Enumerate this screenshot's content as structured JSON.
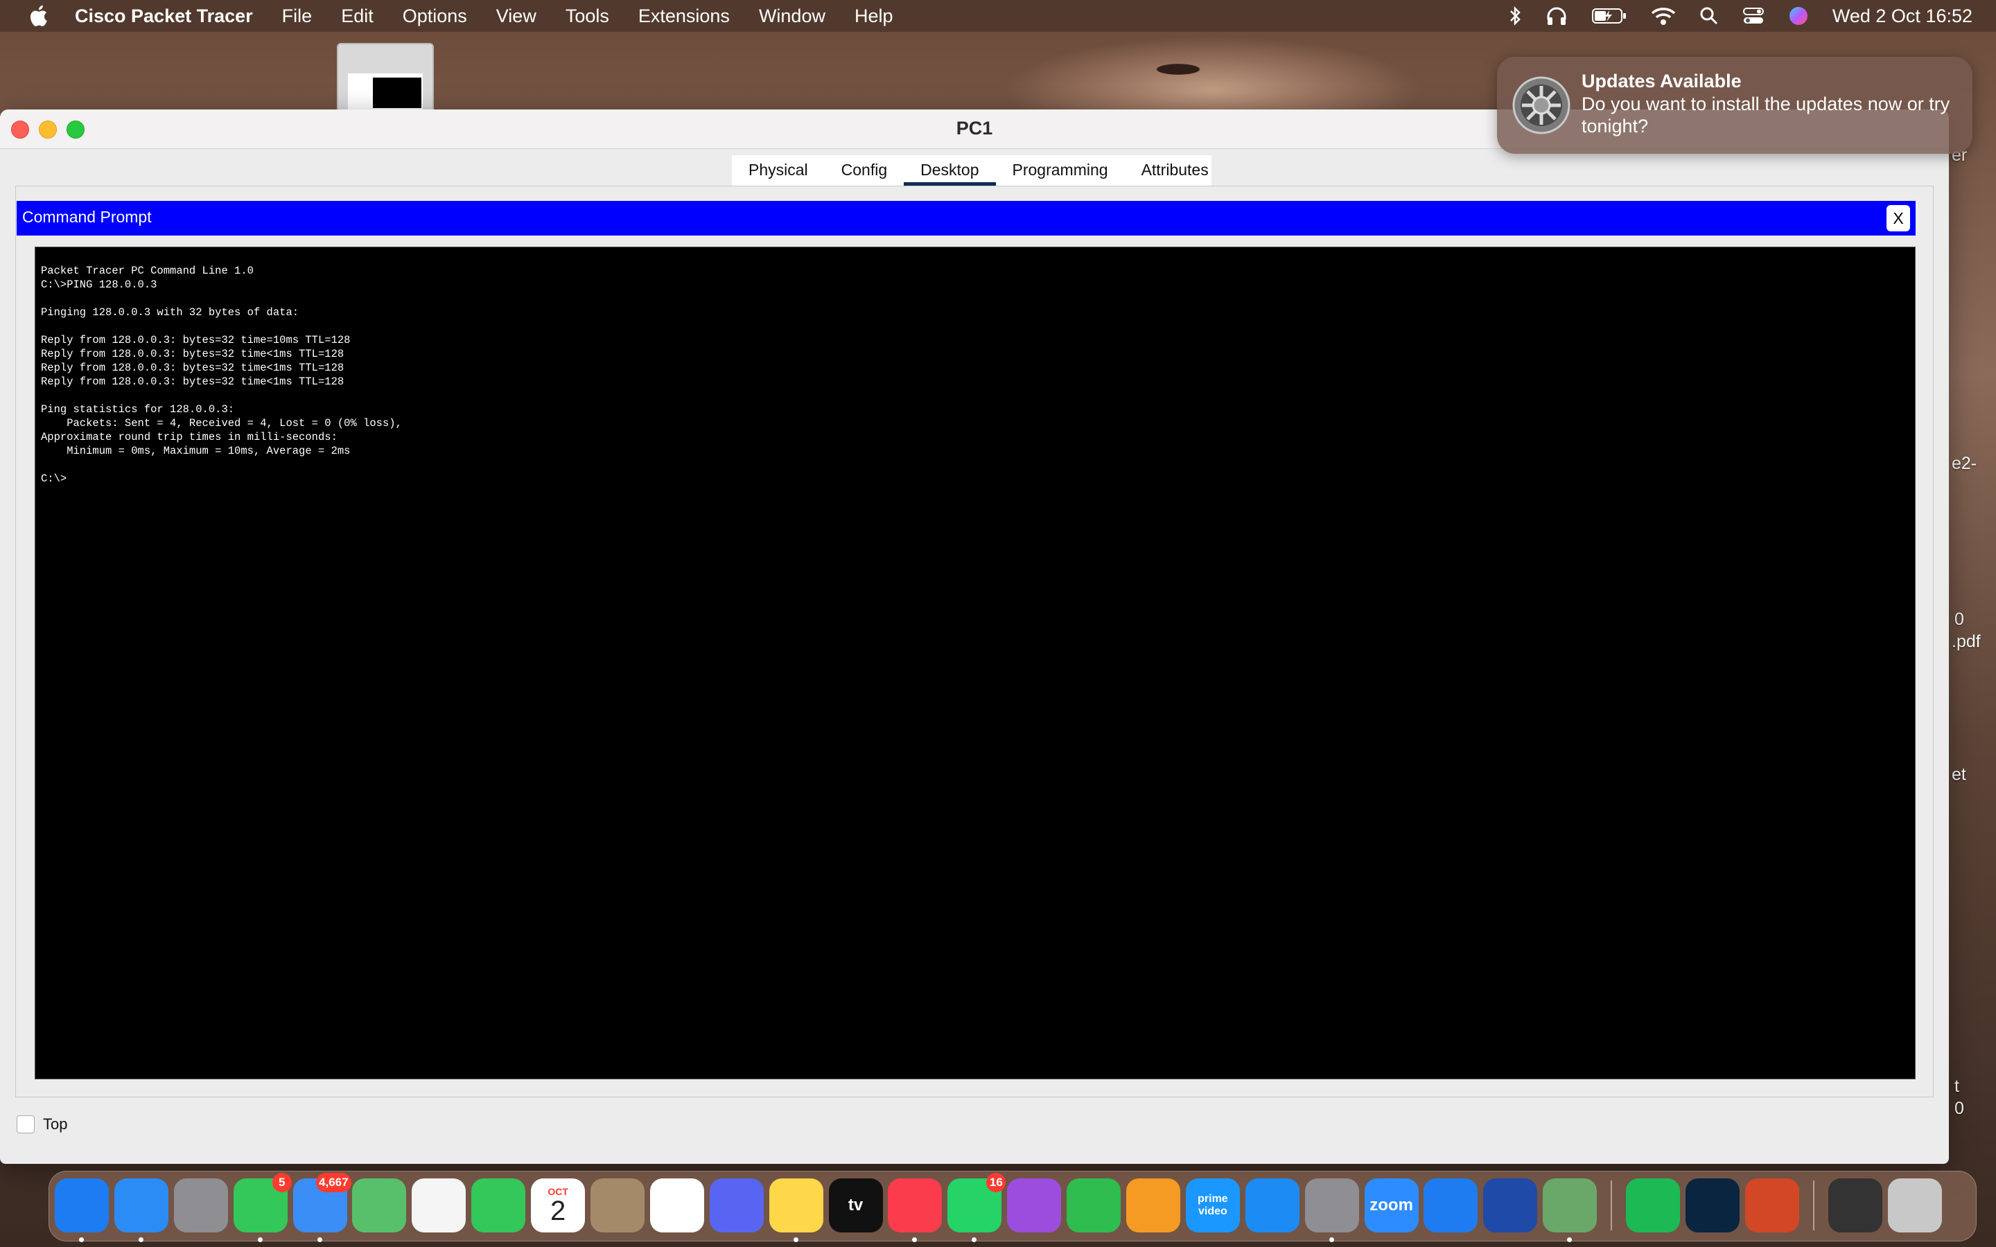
{
  "menubar": {
    "app_name": "Cisco Packet Tracer",
    "menus": [
      "File",
      "Edit",
      "Options",
      "View",
      "Tools",
      "Extensions",
      "Window",
      "Help"
    ],
    "clock": "Wed 2 Oct  16:52"
  },
  "notification": {
    "title": "Updates Available",
    "body": "Do you want to install the updates now or try tonight?"
  },
  "window": {
    "title": "PC1",
    "tabs": [
      {
        "label": "Physical",
        "active": false
      },
      {
        "label": "Config",
        "active": false
      },
      {
        "label": "Desktop",
        "active": true
      },
      {
        "label": "Programming",
        "active": false
      },
      {
        "label": "Attributes",
        "active": false
      }
    ],
    "command_prompt": {
      "title": "Command Prompt",
      "close_label": "X",
      "output": "Packet Tracer PC Command Line 1.0\nC:\\>PING 128.0.0.3\n\nPinging 128.0.0.3 with 32 bytes of data:\n\nReply from 128.0.0.3: bytes=32 time=10ms TTL=128\nReply from 128.0.0.3: bytes=32 time<1ms TTL=128\nReply from 128.0.0.3: bytes=32 time<1ms TTL=128\nReply from 128.0.0.3: bytes=32 time<1ms TTL=128\n\nPing statistics for 128.0.0.3:\n    Packets: Sent = 4, Received = 4, Lost = 0 (0% loss),\nApproximate round trip times in milli-seconds:\n    Minimum = 0ms, Maximum = 10ms, Average = 2ms\n\nC:\\>"
    },
    "top_checkbox": {
      "label": "Top",
      "checked": false
    }
  },
  "desktop_edge_labels": [
    "er",
    "e2-",
    "0",
    ".pdf",
    "et",
    "t",
    "0"
  ],
  "dock": {
    "apps": [
      {
        "name": "finder-icon",
        "color": "#1e7cf2",
        "running": true
      },
      {
        "name": "safari-icon",
        "color": "#2b8cf6",
        "running": true
      },
      {
        "name": "launchpad-icon",
        "color": "#8e8e93",
        "running": false
      },
      {
        "name": "messages-icon",
        "color": "#34c759",
        "running": true,
        "badge": "5"
      },
      {
        "name": "mail-icon",
        "color": "#3a8ef6",
        "running": true,
        "badge": "4,667"
      },
      {
        "name": "maps-icon",
        "color": "#58c06a",
        "running": false
      },
      {
        "name": "photos-icon",
        "color": "#f5f5f5",
        "running": false
      },
      {
        "name": "facetime-icon",
        "color": "#34c759",
        "running": false
      },
      {
        "name": "calendar-icon",
        "color": "#ffffff",
        "running": false,
        "month": "OCT",
        "day": "2"
      },
      {
        "name": "contacts-icon",
        "color": "#a58a6a",
        "running": false
      },
      {
        "name": "reminders-icon",
        "color": "#ffffff",
        "running": false
      },
      {
        "name": "discord-icon",
        "color": "#5865f2",
        "running": false
      },
      {
        "name": "notes-icon",
        "color": "#ffd84a",
        "running": true
      },
      {
        "name": "appletv-icon",
        "color": "#111111",
        "running": false,
        "text": "tv"
      },
      {
        "name": "music-icon",
        "color": "#fa3c4c",
        "running": true
      },
      {
        "name": "whatsapp-icon",
        "color": "#25d366",
        "running": true,
        "badge": "16"
      },
      {
        "name": "podcasts-icon",
        "color": "#9b4dde",
        "running": false
      },
      {
        "name": "numbers-icon",
        "color": "#2fbd4f",
        "running": false
      },
      {
        "name": "pages-icon",
        "color": "#f59a23",
        "running": false
      },
      {
        "name": "prime-video-icon",
        "color": "#1a98ff",
        "running": false,
        "text": "prime video"
      },
      {
        "name": "app-store-icon",
        "color": "#1c8cf4",
        "running": false
      },
      {
        "name": "system-settings-icon",
        "color": "#8e8e93",
        "running": true
      },
      {
        "name": "zoom-icon",
        "color": "#2d8cff",
        "running": false,
        "text": "zoom"
      },
      {
        "name": "keynote-icon",
        "color": "#1f7cf0",
        "running": false
      },
      {
        "name": "packet-tracer-icon",
        "color": "#1f4aa8",
        "running": false
      },
      {
        "name": "preview-icon",
        "color": "#6aa86a",
        "running": true
      },
      {
        "name": "spotify-icon",
        "color": "#1db954",
        "running": false
      },
      {
        "name": "webex-icon",
        "color": "#0a2540",
        "running": false
      },
      {
        "name": "powerpoint-icon",
        "color": "#d24726",
        "running": false
      },
      {
        "name": "downloads-stack-icon",
        "color": "#333333",
        "running": false
      },
      {
        "name": "trash-icon",
        "color": "#c8c8c8",
        "running": false
      }
    ]
  }
}
